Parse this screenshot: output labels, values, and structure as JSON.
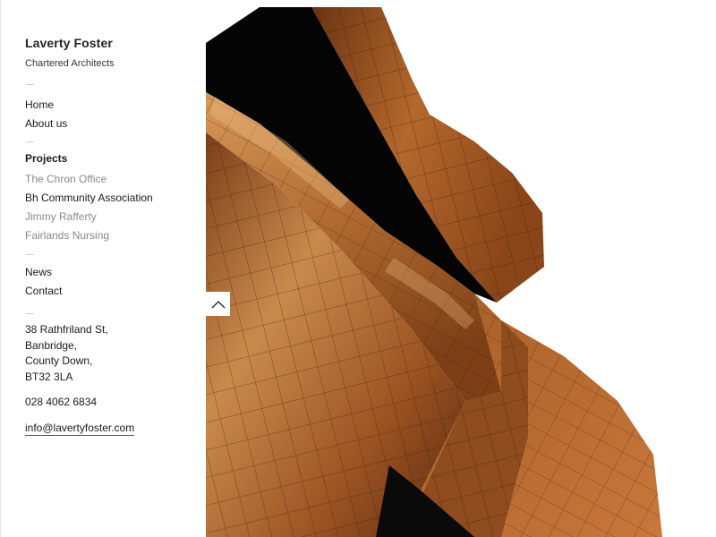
{
  "brand": {
    "name": "Laverty Foster",
    "tagline": "Chartered Architects"
  },
  "nav": {
    "home": "Home",
    "about": "About us",
    "projects_heading": "Projects",
    "projects": [
      "The Chron Office",
      "Bh Community Association",
      "Jimmy Rafferty",
      "Fairlands Nursing"
    ],
    "news": "News",
    "contact": "Contact"
  },
  "address": {
    "lines": [
      "38 Rathfriland St,",
      "Banbridge,",
      "County Down,",
      "BT32 3LA"
    ],
    "phone": "028 4062 6834",
    "email": "info@lavertyfoster.com"
  },
  "hero": {
    "description_icon": "building-facade-image",
    "back_to_top_icon": "chevron-up-icon"
  },
  "colors": {
    "accent_muted": "#8a8a8a",
    "copper": "#b8662a",
    "divider": "#d0d0d0"
  }
}
